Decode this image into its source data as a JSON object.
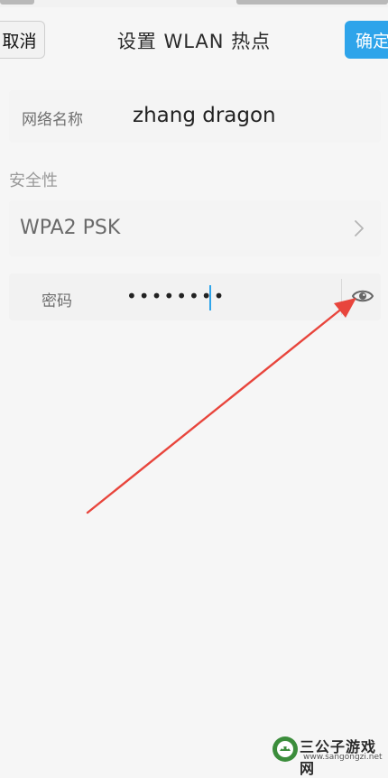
{
  "header": {
    "cancel_label": "取消",
    "title": "设置 WLAN 热点",
    "confirm_label": "确定"
  },
  "network": {
    "name_label": "网络名称",
    "name_value": "zhang dragon"
  },
  "security": {
    "section_label": "安全性",
    "value": "WPA2 PSK"
  },
  "password": {
    "label": "密码",
    "masked_value": "••••••••"
  },
  "watermark": {
    "site_name": "三公子游戏网",
    "url": "www.sangongzi.net"
  },
  "colors": {
    "accent": "#2ea4ea",
    "arrow": "#e8453c",
    "background": "#f6f6f6"
  },
  "icons": [
    "chevron-right-icon",
    "eye-icon",
    "arrow-annotation"
  ]
}
